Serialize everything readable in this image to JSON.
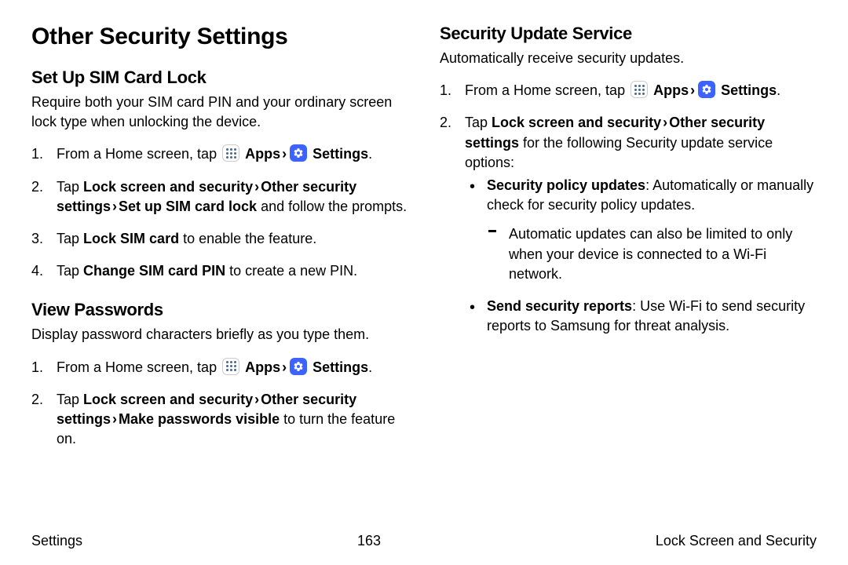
{
  "page_title": "Other Security Settings",
  "icons": {
    "apps_label": "Apps",
    "settings_label": "Settings"
  },
  "left": {
    "sim": {
      "heading": "Set Up SIM Card Lock",
      "intro": "Require both your SIM card PIN and your ordinary screen lock type when unlocking the device.",
      "steps": {
        "s1_pre": "From a Home screen, tap ",
        "s2_b1": "Lock screen and security",
        "s2_b2": "Other security settings",
        "s2_b3": "Set up SIM card lock",
        "s2_tail": " and follow the prompts.",
        "s2_tap": "Tap ",
        "s3_pre": "Tap ",
        "s3_b": "Lock SIM card",
        "s3_tail": " to enable the feature.",
        "s4_pre": "Tap ",
        "s4_b": "Change SIM card PIN",
        "s4_tail": " to create a new PIN."
      }
    },
    "pw": {
      "heading": "View Passwords",
      "intro": "Display password characters briefly as you type them.",
      "steps": {
        "s1_pre": "From a Home screen, tap ",
        "s2_tap": "Tap ",
        "s2_b1": "Lock screen and security",
        "s2_b2": "Other security settings",
        "s2_b3": "Make passwords visible",
        "s2_tail": " to turn the feature on."
      }
    }
  },
  "right": {
    "sus": {
      "heading": "Security Update Service",
      "intro": "Automatically receive security updates.",
      "steps": {
        "s1_pre": "From a Home screen, tap ",
        "s2_tap": "Tap ",
        "s2_b1": "Lock screen and security",
        "s2_b2": "Other security settings",
        "s2_tail": " for the following Security update service options:"
      },
      "bul1_b": "Security policy updates",
      "bul1_tail": ": Automatically or manually check for security policy updates.",
      "dash1": "Automatic updates can also be limited to only when your device is connected to a Wi-Fi network.",
      "bul2_b": "Send security reports",
      "bul2_tail": ": Use Wi-Fi to send security reports to Samsung for threat analysis."
    }
  },
  "footer": {
    "left": "Settings",
    "center": "163",
    "right": "Lock Screen and Security"
  }
}
